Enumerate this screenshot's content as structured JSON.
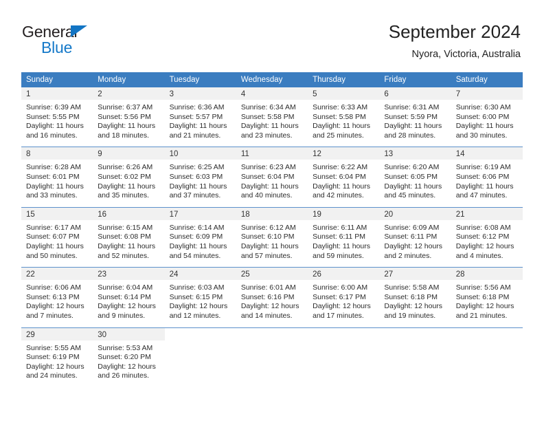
{
  "brand": {
    "name_part1": "General",
    "name_part2": "Blue",
    "triangle_color": "#1275c4",
    "blue_color": "#1579c9",
    "dark_color": "#231f20"
  },
  "header": {
    "title": "September 2024",
    "subtitle": "Nyora, Victoria, Australia"
  },
  "theme": {
    "header_bg": "#3b7dc0",
    "header_text": "#ffffff",
    "daynum_bg": "#f1f1f1",
    "row_divider": "#5b90cb"
  },
  "weekdays": [
    "Sunday",
    "Monday",
    "Tuesday",
    "Wednesday",
    "Thursday",
    "Friday",
    "Saturday"
  ],
  "weeks": [
    [
      {
        "day": "1",
        "sunrise": "Sunrise: 6:39 AM",
        "sunset": "Sunset: 5:55 PM",
        "daylight": "Daylight: 11 hours and 16 minutes."
      },
      {
        "day": "2",
        "sunrise": "Sunrise: 6:37 AM",
        "sunset": "Sunset: 5:56 PM",
        "daylight": "Daylight: 11 hours and 18 minutes."
      },
      {
        "day": "3",
        "sunrise": "Sunrise: 6:36 AM",
        "sunset": "Sunset: 5:57 PM",
        "daylight": "Daylight: 11 hours and 21 minutes."
      },
      {
        "day": "4",
        "sunrise": "Sunrise: 6:34 AM",
        "sunset": "Sunset: 5:58 PM",
        "daylight": "Daylight: 11 hours and 23 minutes."
      },
      {
        "day": "5",
        "sunrise": "Sunrise: 6:33 AM",
        "sunset": "Sunset: 5:58 PM",
        "daylight": "Daylight: 11 hours and 25 minutes."
      },
      {
        "day": "6",
        "sunrise": "Sunrise: 6:31 AM",
        "sunset": "Sunset: 5:59 PM",
        "daylight": "Daylight: 11 hours and 28 minutes."
      },
      {
        "day": "7",
        "sunrise": "Sunrise: 6:30 AM",
        "sunset": "Sunset: 6:00 PM",
        "daylight": "Daylight: 11 hours and 30 minutes."
      }
    ],
    [
      {
        "day": "8",
        "sunrise": "Sunrise: 6:28 AM",
        "sunset": "Sunset: 6:01 PM",
        "daylight": "Daylight: 11 hours and 33 minutes."
      },
      {
        "day": "9",
        "sunrise": "Sunrise: 6:26 AM",
        "sunset": "Sunset: 6:02 PM",
        "daylight": "Daylight: 11 hours and 35 minutes."
      },
      {
        "day": "10",
        "sunrise": "Sunrise: 6:25 AM",
        "sunset": "Sunset: 6:03 PM",
        "daylight": "Daylight: 11 hours and 37 minutes."
      },
      {
        "day": "11",
        "sunrise": "Sunrise: 6:23 AM",
        "sunset": "Sunset: 6:04 PM",
        "daylight": "Daylight: 11 hours and 40 minutes."
      },
      {
        "day": "12",
        "sunrise": "Sunrise: 6:22 AM",
        "sunset": "Sunset: 6:04 PM",
        "daylight": "Daylight: 11 hours and 42 minutes."
      },
      {
        "day": "13",
        "sunrise": "Sunrise: 6:20 AM",
        "sunset": "Sunset: 6:05 PM",
        "daylight": "Daylight: 11 hours and 45 minutes."
      },
      {
        "day": "14",
        "sunrise": "Sunrise: 6:19 AM",
        "sunset": "Sunset: 6:06 PM",
        "daylight": "Daylight: 11 hours and 47 minutes."
      }
    ],
    [
      {
        "day": "15",
        "sunrise": "Sunrise: 6:17 AM",
        "sunset": "Sunset: 6:07 PM",
        "daylight": "Daylight: 11 hours and 50 minutes."
      },
      {
        "day": "16",
        "sunrise": "Sunrise: 6:15 AM",
        "sunset": "Sunset: 6:08 PM",
        "daylight": "Daylight: 11 hours and 52 minutes."
      },
      {
        "day": "17",
        "sunrise": "Sunrise: 6:14 AM",
        "sunset": "Sunset: 6:09 PM",
        "daylight": "Daylight: 11 hours and 54 minutes."
      },
      {
        "day": "18",
        "sunrise": "Sunrise: 6:12 AM",
        "sunset": "Sunset: 6:10 PM",
        "daylight": "Daylight: 11 hours and 57 minutes."
      },
      {
        "day": "19",
        "sunrise": "Sunrise: 6:11 AM",
        "sunset": "Sunset: 6:11 PM",
        "daylight": "Daylight: 11 hours and 59 minutes."
      },
      {
        "day": "20",
        "sunrise": "Sunrise: 6:09 AM",
        "sunset": "Sunset: 6:11 PM",
        "daylight": "Daylight: 12 hours and 2 minutes."
      },
      {
        "day": "21",
        "sunrise": "Sunrise: 6:08 AM",
        "sunset": "Sunset: 6:12 PM",
        "daylight": "Daylight: 12 hours and 4 minutes."
      }
    ],
    [
      {
        "day": "22",
        "sunrise": "Sunrise: 6:06 AM",
        "sunset": "Sunset: 6:13 PM",
        "daylight": "Daylight: 12 hours and 7 minutes."
      },
      {
        "day": "23",
        "sunrise": "Sunrise: 6:04 AM",
        "sunset": "Sunset: 6:14 PM",
        "daylight": "Daylight: 12 hours and 9 minutes."
      },
      {
        "day": "24",
        "sunrise": "Sunrise: 6:03 AM",
        "sunset": "Sunset: 6:15 PM",
        "daylight": "Daylight: 12 hours and 12 minutes."
      },
      {
        "day": "25",
        "sunrise": "Sunrise: 6:01 AM",
        "sunset": "Sunset: 6:16 PM",
        "daylight": "Daylight: 12 hours and 14 minutes."
      },
      {
        "day": "26",
        "sunrise": "Sunrise: 6:00 AM",
        "sunset": "Sunset: 6:17 PM",
        "daylight": "Daylight: 12 hours and 17 minutes."
      },
      {
        "day": "27",
        "sunrise": "Sunrise: 5:58 AM",
        "sunset": "Sunset: 6:18 PM",
        "daylight": "Daylight: 12 hours and 19 minutes."
      },
      {
        "day": "28",
        "sunrise": "Sunrise: 5:56 AM",
        "sunset": "Sunset: 6:18 PM",
        "daylight": "Daylight: 12 hours and 21 minutes."
      }
    ],
    [
      {
        "day": "29",
        "sunrise": "Sunrise: 5:55 AM",
        "sunset": "Sunset: 6:19 PM",
        "daylight": "Daylight: 12 hours and 24 minutes."
      },
      {
        "day": "30",
        "sunrise": "Sunrise: 5:53 AM",
        "sunset": "Sunset: 6:20 PM",
        "daylight": "Daylight: 12 hours and 26 minutes."
      },
      {
        "day": "",
        "sunrise": "",
        "sunset": "",
        "daylight": ""
      },
      {
        "day": "",
        "sunrise": "",
        "sunset": "",
        "daylight": ""
      },
      {
        "day": "",
        "sunrise": "",
        "sunset": "",
        "daylight": ""
      },
      {
        "day": "",
        "sunrise": "",
        "sunset": "",
        "daylight": ""
      },
      {
        "day": "",
        "sunrise": "",
        "sunset": "",
        "daylight": ""
      }
    ]
  ]
}
